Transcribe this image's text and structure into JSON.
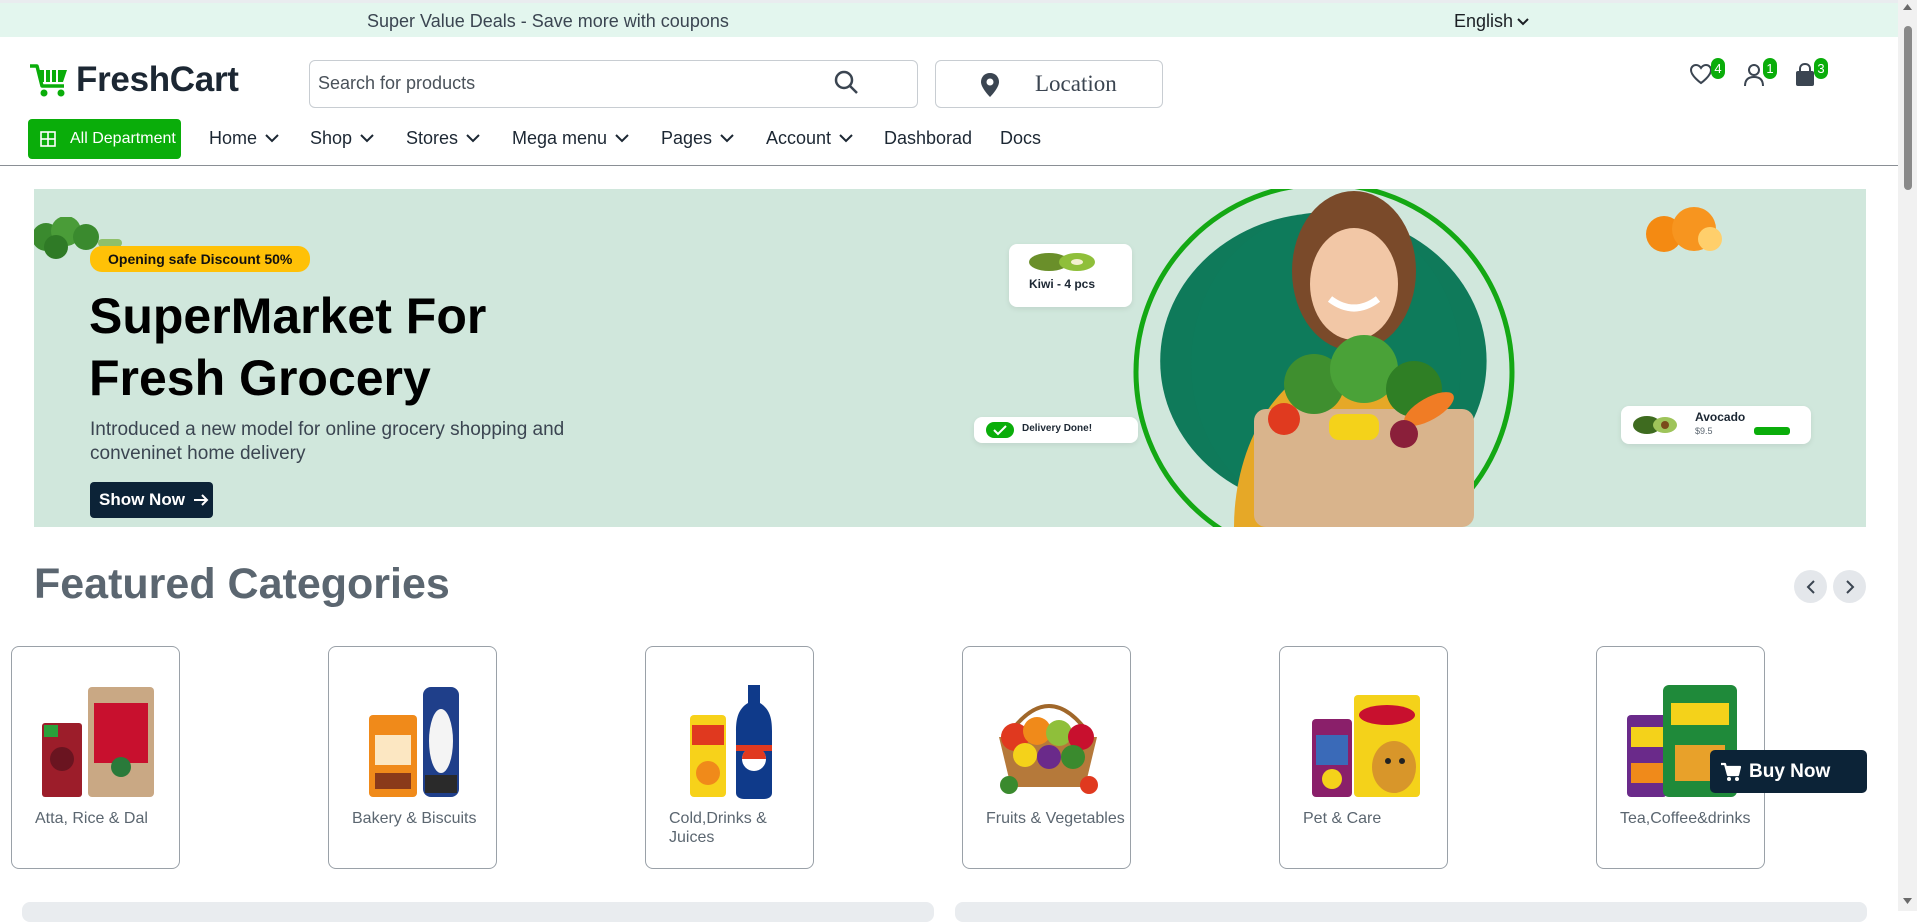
{
  "topbar": {
    "deal_text": "Super Value Deals - Save more with coupons",
    "language": "English"
  },
  "header": {
    "brand": "FreshCart",
    "search_placeholder": "Search for products",
    "location_label": "Location",
    "wishlist_count": "4",
    "account_count": "1",
    "cart_count": "3"
  },
  "nav": {
    "all_department": "All Department",
    "items": [
      {
        "label": "Home",
        "dropdown": true
      },
      {
        "label": "Shop",
        "dropdown": true
      },
      {
        "label": "Stores",
        "dropdown": true
      },
      {
        "label": "Mega menu",
        "dropdown": true
      },
      {
        "label": "Pages",
        "dropdown": true
      },
      {
        "label": "Account",
        "dropdown": true
      },
      {
        "label": "Dashborad",
        "dropdown": false
      },
      {
        "label": "Docs",
        "dropdown": false
      }
    ]
  },
  "hero": {
    "tag": "Opening safe Discount 50%",
    "title": "SuperMarket For Fresh Grocery",
    "subtitle": "Introduced a new model for online grocery shopping and conveninet home delivery",
    "cta": "Show Now",
    "float_kiwi": "Kiwi - 4 pcs",
    "float_delivery": "Delivery Done!",
    "float_avocado": "Avocado",
    "float_avocado_price": "$9.5"
  },
  "featured": {
    "title": "Featured Categories",
    "categories": [
      {
        "name": "Atta, Rice & Dal"
      },
      {
        "name": "Bakery & Biscuits"
      },
      {
        "name": "Cold,Drinks & Juices"
      },
      {
        "name": "Fruits & Vegetables"
      },
      {
        "name": "Pet & Care"
      },
      {
        "name": "Tea,Coffee&drinks"
      }
    ]
  },
  "buy_now": "Buy Now",
  "colors": {
    "brand_green": "#0aad0a",
    "dark_navy": "#0c2337",
    "hero_bg": "#d0e7dc",
    "topbar_bg": "#e3f6ee",
    "discount_yellow": "#ffc107"
  },
  "icons": {
    "wishlist": "heart-icon",
    "account": "user-icon",
    "cart": "shopping-bag-icon",
    "search": "search-icon",
    "location": "map-pin-icon",
    "all_department": "grid-icon"
  }
}
